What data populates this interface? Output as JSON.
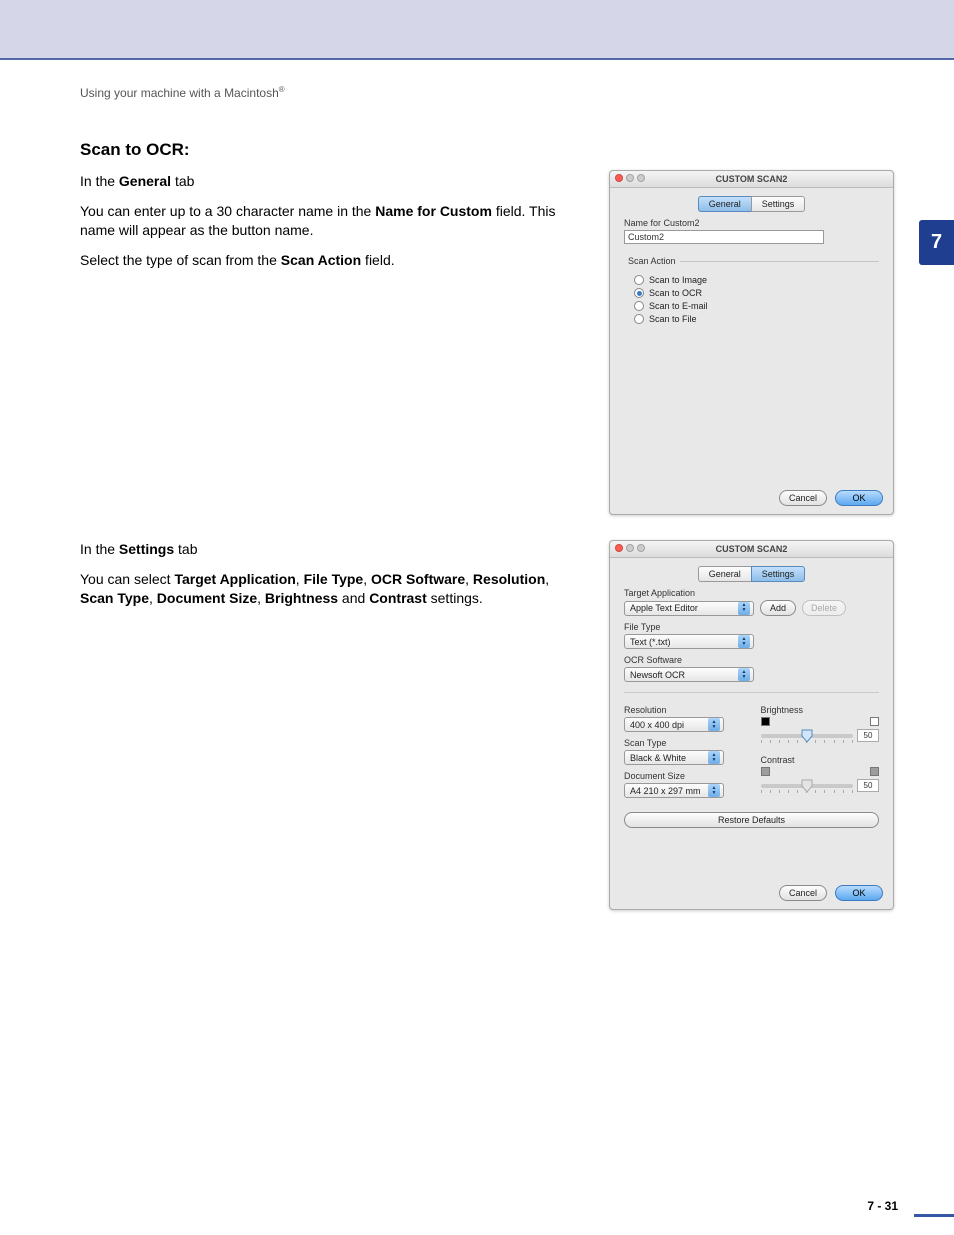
{
  "header": "Using your machine with a Macintosh",
  "chapter_number": "7",
  "section_title": "Scan to OCR:",
  "para1_prefix": "In the ",
  "para1_bold": "General",
  "para1_suffix": " tab",
  "para2a": "You can enter up to a 30 character name in the ",
  "para2b": "Name for Custom",
  "para2c": " field. This name will appear as the button name.",
  "para3a": "Select the type of scan from the ",
  "para3b": "Scan Action",
  "para3c": " field.",
  "para4_prefix": "In the ",
  "para4_bold": "Settings",
  "para4_suffix": " tab",
  "para5a": "You can select ",
  "para5_b1": "Target Application",
  "para5_s1": ", ",
  "para5_b2": "File Type",
  "para5_s2": ", ",
  "para5_b3": "OCR Software",
  "para5_s3": ", ",
  "para5_b4": "Resolution",
  "para5_s4": ", ",
  "para5_b5": "Scan Type",
  "para5_s5": ", ",
  "para5_b6": "Document Size",
  "para5_s6": ", ",
  "para5_b7": "Brightness",
  "para5_s7": " and ",
  "para5_b8": "Contrast",
  "para5_end": " settings.",
  "dialog_title": "CUSTOM SCAN2",
  "tab_general": "General",
  "tab_settings": "Settings",
  "name_for_custom_label": "Name for Custom2",
  "name_for_custom_value": "Custom2",
  "scan_action_label": "Scan Action",
  "scan_actions": {
    "image": "Scan to Image",
    "ocr": "Scan to OCR",
    "email": "Scan to E-mail",
    "file": "Scan to File"
  },
  "btn_cancel": "Cancel",
  "btn_ok": "OK",
  "btn_add": "Add",
  "btn_delete": "Delete",
  "btn_restore": "Restore Defaults",
  "labels": {
    "target_app": "Target Application",
    "file_type": "File Type",
    "ocr_software": "OCR Software",
    "resolution": "Resolution",
    "scan_type": "Scan Type",
    "document_size": "Document Size",
    "brightness": "Brightness",
    "contrast": "Contrast"
  },
  "values": {
    "target_app": "Apple Text Editor",
    "file_type": "Text (*.txt)",
    "ocr_software": "Newsoft OCR",
    "resolution": "400 x 400 dpi",
    "scan_type": "Black & White",
    "document_size": "A4 210 x 297 mm",
    "brightness": "50",
    "contrast": "50"
  },
  "page_footer": "7 - 31"
}
